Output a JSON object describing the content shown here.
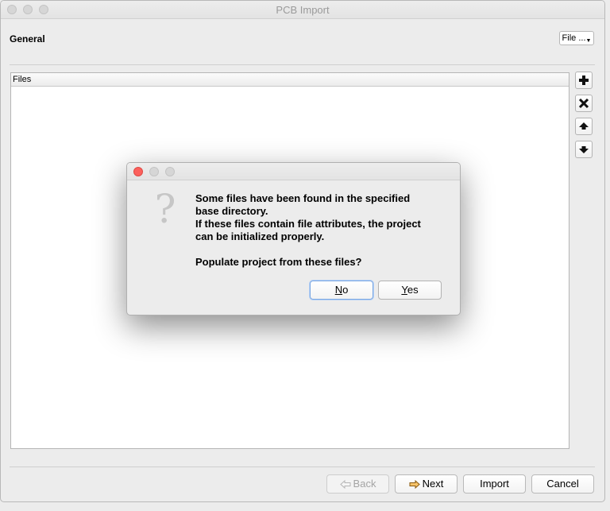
{
  "window": {
    "title": "PCB Import"
  },
  "general": {
    "title": "General",
    "file_menu_label": "File ..."
  },
  "files": {
    "header": "Files",
    "rows": []
  },
  "side_buttons": {
    "add_icon": "plus-icon",
    "remove_icon": "close-icon",
    "up_icon": "arrow-up-icon",
    "down_icon": "arrow-down-icon"
  },
  "footer": {
    "back_label": "Back",
    "next_label": "Next",
    "import_label": "Import",
    "cancel_label": "Cancel"
  },
  "dialog": {
    "icon": "question-icon",
    "lines": [
      "Some files have been found in the specified",
      "base directory.",
      "If these files contain file attributes, the project",
      "can be initialized properly."
    ],
    "question": "Populate project from these files?",
    "no_mnemonic": "N",
    "no_rest": "o",
    "yes_mnemonic": "Y",
    "yes_rest": "es"
  },
  "colors": {
    "close_button": "#fc605c",
    "focus_ring": "#79a6e3",
    "arrow_accent": "#f0a030"
  }
}
